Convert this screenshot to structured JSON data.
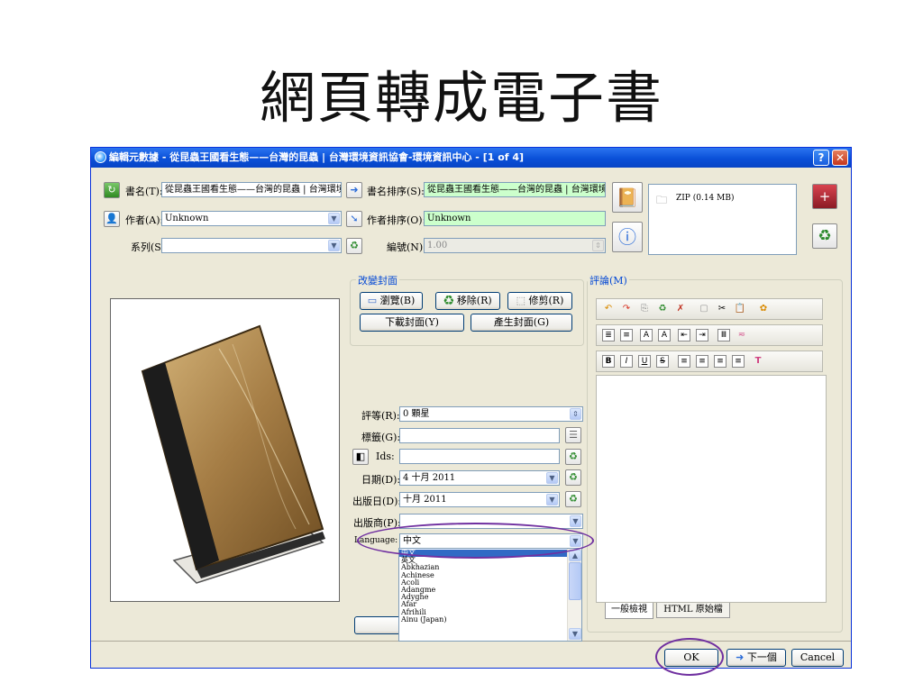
{
  "slide": {
    "title": "網頁轉成電子書"
  },
  "window": {
    "title": "編輯元數據 - 從昆蟲王國看生態——台灣的昆蟲 | 台灣環境資訊協會-環境資訊中心 -  [1 of 4]",
    "help_label": "?",
    "close_label": "✕"
  },
  "metadata": {
    "title_label": "書名(T):",
    "title_value": "從昆蟲王國看生態——台灣的昆蟲 | 台灣環境",
    "title_sort_label": "書名排序(S):",
    "title_sort_value": "從昆蟲王國看生態——台灣的昆蟲 | 台灣環境",
    "author_label": "作者(A):",
    "author_value": "Unknown",
    "author_sort_label": "作者排序(O):",
    "author_sort_value": "Unknown",
    "series_label": "系列(S):",
    "series_value": "",
    "number_label": "編號(N):",
    "number_value": "1.00"
  },
  "formats": {
    "zip_label": "ZIP (0.14 MB)"
  },
  "cover": {
    "group_title": "改變封面",
    "browse_label": "瀏覽(B)",
    "remove_label": "移除(R)",
    "trim_label": "修剪(R)",
    "download_label": "下載封面(Y)",
    "generate_label": "產生封面(G)"
  },
  "details": {
    "rating_label": "評等(R):",
    "rating_value": "0 顆星",
    "tags_label": "標籤(G):",
    "tags_value": "",
    "ids_label": "Ids:",
    "ids_value": "",
    "date_label": "日期(D):",
    "date_value": "4 十月 2011",
    "pubdate_label": "出版日(D):",
    "pubdate_value": "十月 2011",
    "publisher_label": "出版商(P):",
    "publisher_value": "",
    "language_label": "Language:",
    "language_value": "中文"
  },
  "language_options": [
    "中文",
    "英文",
    "Abkhazian",
    "Achinese",
    "Acoli",
    "Adangme",
    "Adyghe",
    "Afar",
    "Afrihili",
    "Ainu (Japan)"
  ],
  "comments": {
    "group_title": "評論(M)",
    "tab_normal": "一般檢視",
    "tab_html": "HTML 原始檔"
  },
  "footer": {
    "ok_label": "OK",
    "next_label": "下一個",
    "cancel_label": "Cancel"
  },
  "colors": {
    "highlight_ellipse": "#7030a0",
    "titlebar": "#0a50d8",
    "green_field": "#ccffcc"
  }
}
